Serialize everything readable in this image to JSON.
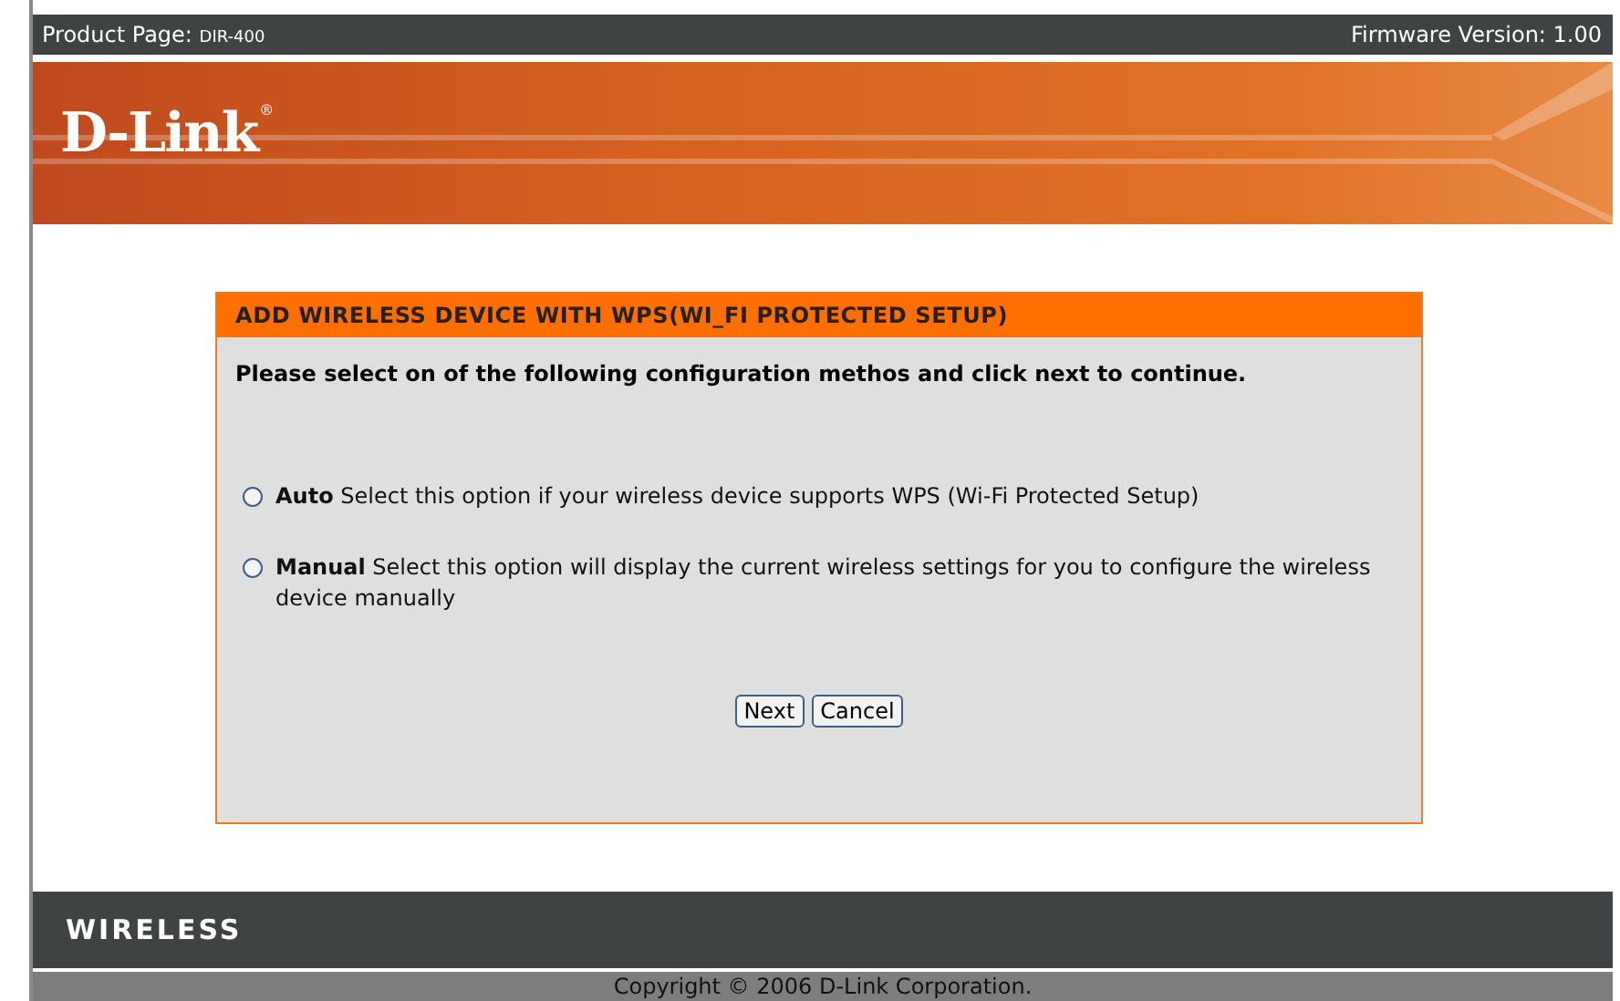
{
  "top_bar": {
    "product_label": "Product Page:",
    "product_model": "DIR-400",
    "firmware": "Firmware Version: 1.00"
  },
  "banner": {
    "logo": "D-Link",
    "logo_mark": "®"
  },
  "panel": {
    "title": "ADD WIRELESS DEVICE WITH WPS(WI_FI PROTECTED SETUP)",
    "instruction": "Please select on of the following configuration methos and click next to continue.",
    "options": [
      {
        "label": "Auto",
        "description": "Select this option if your wireless device supports WPS (Wi-Fi Protected Setup)",
        "selected": false
      },
      {
        "label": "Manual",
        "description": "Select this option will display the current wireless settings for you to configure the wireless device manually",
        "selected": false
      }
    ],
    "buttons": [
      "Next",
      "Cancel"
    ]
  },
  "bottom_bar": {
    "label": "WIRELESS"
  },
  "footer": {
    "copyright": "Copyright © 2006 D-Link Corporation."
  }
}
